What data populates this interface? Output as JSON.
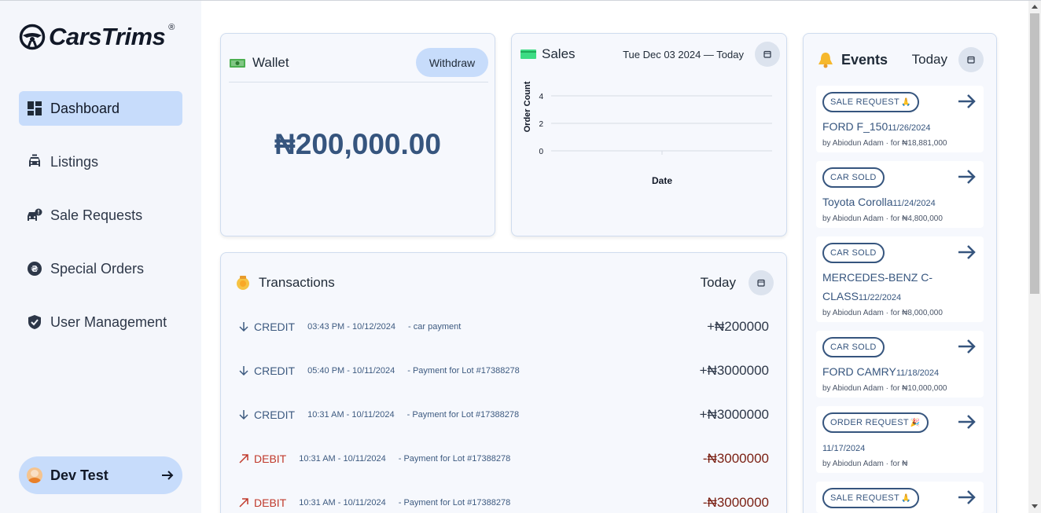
{
  "brand": {
    "name": "CarsTrims",
    "reg": "®"
  },
  "sidebar": {
    "items": [
      {
        "label": "Dashboard",
        "icon": "dashboard-icon",
        "active": true
      },
      {
        "label": "Listings",
        "icon": "car-icon"
      },
      {
        "label": "Sale Requests",
        "icon": "car-alert-icon"
      },
      {
        "label": "Special Orders",
        "icon": "currency-exchange-icon"
      },
      {
        "label": "User Management",
        "icon": "shield-check-icon"
      }
    ],
    "user": {
      "name": "Dev Test"
    }
  },
  "wallet": {
    "title": "Wallet",
    "withdraw_label": "Withdraw",
    "amount": "₦200,000.00"
  },
  "sales": {
    "title": "Sales",
    "date_range": "Tue Dec 03 2024 — Today"
  },
  "chart_data": {
    "type": "line",
    "xlabel": "Date",
    "ylabel": "Order Count",
    "y_ticks": [
      "0",
      "2",
      "4"
    ],
    "ylim": [
      0,
      4
    ],
    "series": []
  },
  "transactions": {
    "title": "Transactions",
    "period": "Today",
    "rows": [
      {
        "type": "CREDIT",
        "time": "03:43 PM - 10/12/2024",
        "desc": "- car payment",
        "amount": "+₦200000"
      },
      {
        "type": "CREDIT",
        "time": "05:40 PM - 10/11/2024",
        "desc": "- Payment for Lot #17388278",
        "amount": "+₦3000000"
      },
      {
        "type": "CREDIT",
        "time": "10:31 AM - 10/11/2024",
        "desc": "- Payment for Lot #17388278",
        "amount": "+₦3000000"
      },
      {
        "type": "DEBIT",
        "time": "10:31 AM - 10/11/2024",
        "desc": "- Payment for Lot #17388278",
        "amount": "-₦3000000"
      },
      {
        "type": "DEBIT",
        "time": "10:31 AM - 10/11/2024",
        "desc": "- Payment for Lot #17388278",
        "amount": "-₦3000000"
      }
    ]
  },
  "events": {
    "title": "Events",
    "period": "Today",
    "items": [
      {
        "badge": "SALE REQUEST",
        "emoji": "🙏",
        "name": "FORD F_150",
        "date": "11/26/2024",
        "by": "by Abiodun Adam · for ₦18,881,000"
      },
      {
        "badge": "CAR SOLD",
        "emoji": "",
        "name": "Toyota Corolla",
        "date": "11/24/2024",
        "by": "by Abiodun Adam · for ₦4,800,000"
      },
      {
        "badge": "CAR SOLD",
        "emoji": "",
        "name": "MERCEDES-BENZ C-CLASS",
        "date": "11/22/2024",
        "by": "by Abiodun Adam · for ₦8,000,000"
      },
      {
        "badge": "CAR SOLD",
        "emoji": "",
        "name": "FORD CAMRY",
        "date": "11/18/2024",
        "by": "by Abiodun Adam · for ₦10,000,000"
      },
      {
        "badge": "ORDER REQUEST",
        "emoji": "🎉",
        "name": "",
        "date": "11/17/2024",
        "by": "by Abiodun Adam · for ₦"
      },
      {
        "badge": "SALE REQUEST",
        "emoji": "🙏",
        "name": "",
        "date": "",
        "by": ""
      }
    ]
  },
  "colors": {
    "accent": "#c7dcfb",
    "primary_text": "#36557e",
    "credit": "#3d5a80",
    "debit": "#c0392b"
  }
}
